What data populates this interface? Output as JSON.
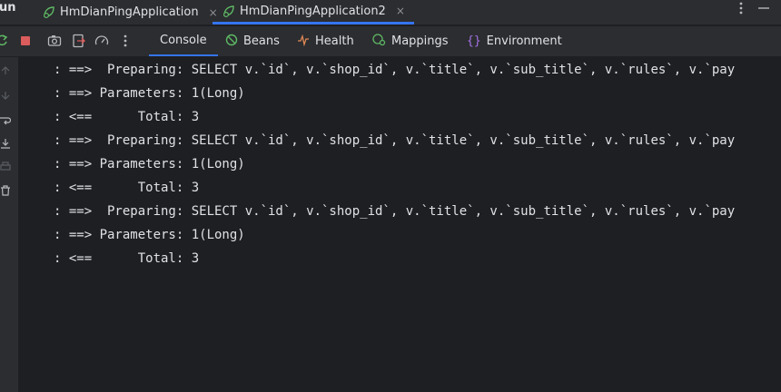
{
  "run_panel": {
    "title": "Run",
    "tabs": [
      {
        "label": "HmDianPingApplication",
        "active": false
      },
      {
        "label": "HmDianPingApplication2",
        "active": true
      }
    ],
    "close_glyph": "×"
  },
  "toolbar": {
    "icons": [
      "rerun-icon",
      "stop-icon",
      "camera-icon",
      "exit-icon",
      "gauge-icon",
      "more-icon"
    ],
    "sub_tabs": [
      {
        "label": "Console",
        "icon": "none",
        "active": true
      },
      {
        "label": "Beans",
        "icon": "beans-icon",
        "active": false
      },
      {
        "label": "Health",
        "icon": "health-icon",
        "active": false
      },
      {
        "label": "Mappings",
        "icon": "mappings-icon",
        "active": false
      },
      {
        "label": "Environment",
        "icon": "environment-icon",
        "active": false
      }
    ]
  },
  "console": {
    "lines": [
      ": ==>  Preparing: SELECT v.`id`, v.`shop_id`, v.`title`, v.`sub_title`, v.`rules`, v.`pay",
      ": ==> Parameters: 1(Long)",
      ": <==      Total: 3",
      ": ==>  Preparing: SELECT v.`id`, v.`shop_id`, v.`title`, v.`sub_title`, v.`rules`, v.`pay",
      ": ==> Parameters: 1(Long)",
      ": <==      Total: 3",
      ": ==>  Preparing: SELECT v.`id`, v.`shop_id`, v.`title`, v.`sub_title`, v.`rules`, v.`pay",
      ": ==> Parameters: 1(Long)",
      ": <==      Total: 3"
    ]
  },
  "colors": {
    "accent": "#3574f0",
    "panel_bg": "#2b2d30",
    "console_bg": "#1e1f22",
    "text": "#dfe1e5",
    "stop_red": "#db5c5c",
    "run_green": "#5fb865"
  }
}
